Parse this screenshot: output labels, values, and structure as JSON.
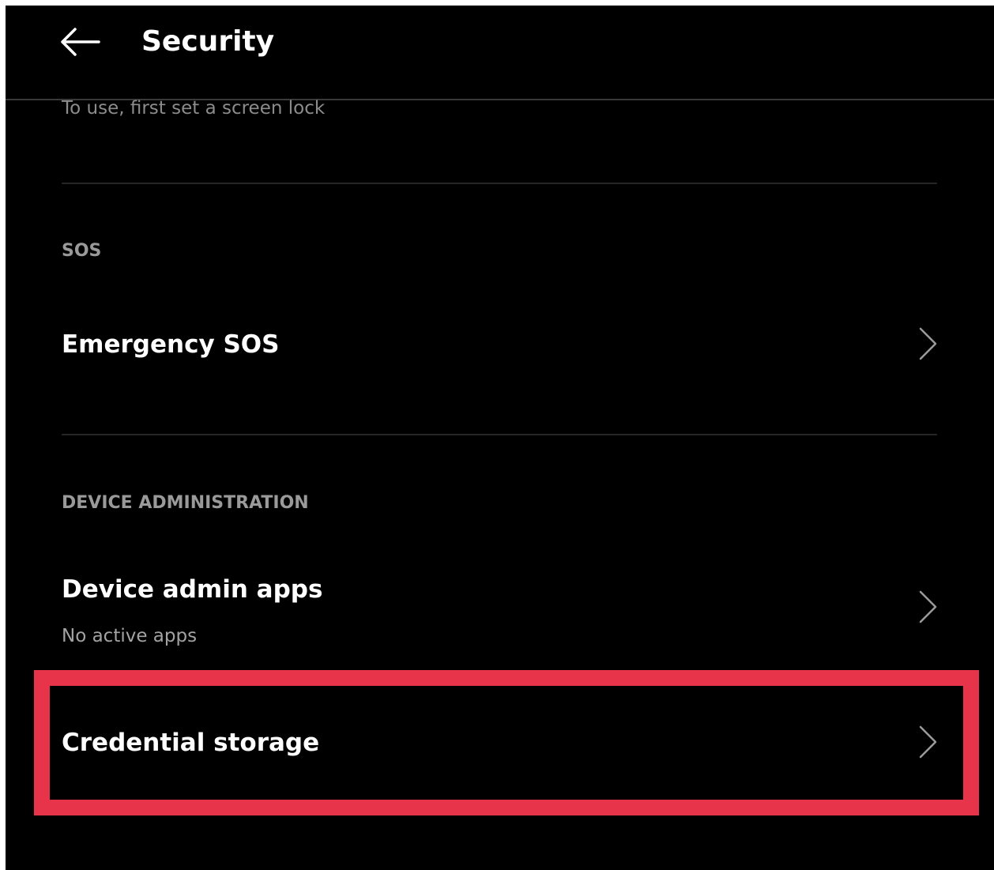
{
  "header": {
    "title": "Security",
    "back_icon": "arrow-left-icon"
  },
  "screen_lock_hint": "To use, first set a screen lock",
  "sections": {
    "sos": {
      "header": "SOS",
      "items": [
        {
          "title": "Emergency SOS",
          "icon": "chevron-right-icon"
        }
      ]
    },
    "device_administration": {
      "header": "DEVICE ADMINISTRATION",
      "items": [
        {
          "title": "Device admin apps",
          "subtitle": "No active apps",
          "icon": "chevron-right-icon"
        },
        {
          "title": "Credential storage",
          "icon": "chevron-right-icon"
        }
      ]
    }
  },
  "colors": {
    "background": "#000000",
    "primary_text": "#ffffff",
    "secondary_text": "#9a9a9a",
    "highlight": "#e8344a"
  }
}
